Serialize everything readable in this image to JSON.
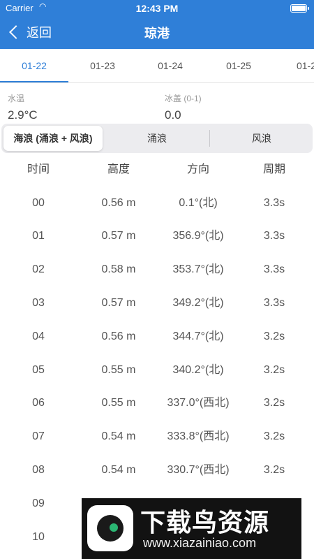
{
  "status_bar": {
    "carrier": "Carrier",
    "time": "12:43 PM"
  },
  "nav": {
    "back_label": "返回",
    "title": "琼港"
  },
  "date_tabs": [
    "01-22",
    "01-23",
    "01-24",
    "01-25",
    "01-2"
  ],
  "active_date_index": 0,
  "info": {
    "water_temp_label": "水温",
    "water_temp_value": "2.9°C",
    "ice_label": "冰盖 (0-1)",
    "ice_value": "0.0"
  },
  "wave_tabs": [
    "海浪 (涌浪 + 风浪)",
    "涌浪",
    "风浪"
  ],
  "active_wave_tab": 0,
  "table": {
    "headers": [
      "时间",
      "高度",
      "方向",
      "周期"
    ],
    "rows": [
      [
        "00",
        "0.56 m",
        "0.1°(北)",
        "3.3s"
      ],
      [
        "01",
        "0.57 m",
        "356.9°(北)",
        "3.3s"
      ],
      [
        "02",
        "0.58 m",
        "353.7°(北)",
        "3.3s"
      ],
      [
        "03",
        "0.57 m",
        "349.2°(北)",
        "3.3s"
      ],
      [
        "04",
        "0.56 m",
        "344.7°(北)",
        "3.2s"
      ],
      [
        "05",
        "0.55 m",
        "340.2°(北)",
        "3.2s"
      ],
      [
        "06",
        "0.55 m",
        "337.0°(西北)",
        "3.2s"
      ],
      [
        "07",
        "0.54 m",
        "333.8°(西北)",
        "3.2s"
      ],
      [
        "08",
        "0.54 m",
        "330.7°(西北)",
        "3.2s"
      ],
      [
        "09",
        "",
        "",
        ""
      ],
      [
        "10",
        "",
        "",
        ""
      ]
    ]
  },
  "watermark": {
    "title": "下载鸟资源",
    "url": "www.xiazainiao.com"
  }
}
